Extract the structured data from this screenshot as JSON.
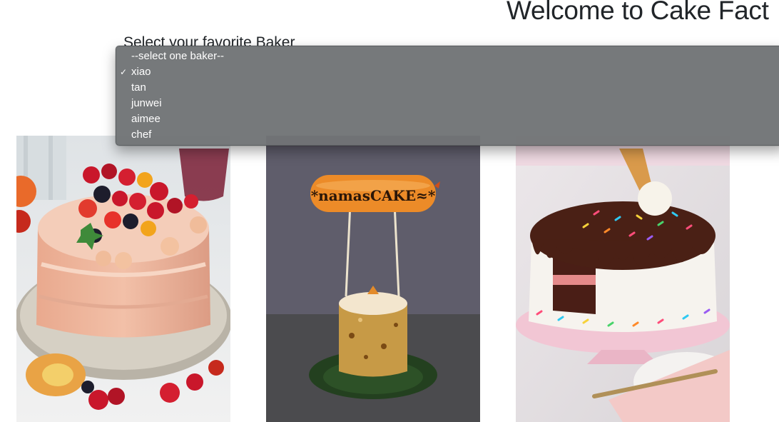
{
  "header": {
    "title": "Welcome to Cake Fact",
    "select_label": "Select your favorite Baker"
  },
  "baker_select": {
    "selected_value": "xiao",
    "options": [
      {
        "label": "--select one baker--",
        "checked": false
      },
      {
        "label": "xiao",
        "checked": true
      },
      {
        "label": "tan",
        "checked": false
      },
      {
        "label": "junwei",
        "checked": false
      },
      {
        "label": "aimee",
        "checked": false
      },
      {
        "label": "chef",
        "checked": false
      }
    ],
    "check_glyph": "✓"
  },
  "cakes": [
    {
      "subject": "naked cake with fresh berries and cherries"
    },
    {
      "subject": "small cake with sausage topper",
      "topper_text": "*namasCAKE≈*"
    },
    {
      "subject": "chocolate drip cake with sprinkles and ice cream cone"
    }
  ],
  "colors": {
    "dropdown_bg": "#707476",
    "dropdown_text": "#ffffff",
    "title_text": "#212529"
  }
}
